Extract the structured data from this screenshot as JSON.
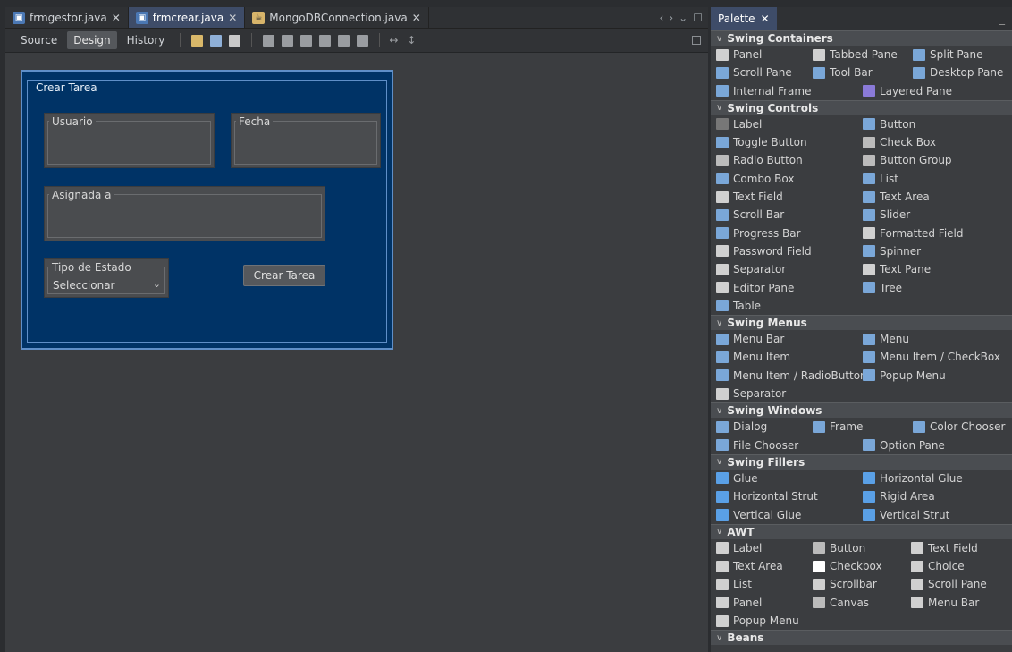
{
  "editor": {
    "tabs": [
      {
        "label": "frmgestor.java",
        "close": "✕",
        "icon": "java-form-file-icon"
      },
      {
        "label": "frmcrear.java",
        "close": "✕",
        "icon": "java-form-file-icon"
      },
      {
        "label": "MongoDBConnection.java",
        "close": "✕",
        "icon": "java-class-file-icon"
      }
    ],
    "views": {
      "source": "Source",
      "design": "Design",
      "history": "History"
    }
  },
  "form": {
    "title": "Crear Tarea",
    "usuario_label": "Usuario",
    "fecha_label": "Fecha",
    "asignada_label": "Asignada a",
    "tipo_estado_label": "Tipo de Estado",
    "combo_value": "Seleccionar",
    "crear_button": "Crear Tarea"
  },
  "palette": {
    "tab_label": "Palette",
    "close": "✕",
    "categories": [
      {
        "name": "Swing Containers",
        "rows": [
          [
            {
              "label": "Panel",
              "icon": "panel-icon",
              "color": "#d0d0d0"
            },
            {
              "label": "Tabbed Pane",
              "icon": "tabbed-pane-icon",
              "color": "#d0d0d0"
            },
            {
              "label": "Split Pane",
              "icon": "split-pane-icon",
              "color": "#7aa7d8"
            }
          ],
          [
            {
              "label": "Scroll Pane",
              "icon": "scroll-pane-icon",
              "color": "#7aa7d8"
            },
            {
              "label": "Tool Bar",
              "icon": "tool-bar-icon",
              "color": "#7aa7d8"
            },
            {
              "label": "Desktop Pane",
              "icon": "desktop-pane-icon",
              "color": "#7aa7d8"
            }
          ],
          [
            {
              "label": "Internal Frame",
              "icon": "internal-frame-icon",
              "color": "#7aa7d8"
            },
            {
              "label": "Layered Pane",
              "icon": "layered-pane-icon",
              "color": "#8a7ad8"
            }
          ]
        ]
      },
      {
        "name": "Swing Controls",
        "rows": [
          [
            {
              "label": "Label",
              "icon": "label-icon",
              "color": "#777"
            },
            {
              "label": "Button",
              "icon": "button-icon",
              "color": "#7aa7d8"
            }
          ],
          [
            {
              "label": "Toggle Button",
              "icon": "toggle-button-icon",
              "color": "#7aa7d8"
            },
            {
              "label": "Check Box",
              "icon": "check-box-icon",
              "color": "#bbbbbb"
            }
          ],
          [
            {
              "label": "Radio Button",
              "icon": "radio-button-icon",
              "color": "#bbbbbb"
            },
            {
              "label": "Button Group",
              "icon": "button-group-icon",
              "color": "#bbbbbb"
            }
          ],
          [
            {
              "label": "Combo Box",
              "icon": "combo-box-icon",
              "color": "#7aa7d8"
            },
            {
              "label": "List",
              "icon": "list-icon",
              "color": "#7aa7d8"
            }
          ],
          [
            {
              "label": "Text Field",
              "icon": "text-field-icon",
              "color": "#d0d0d0"
            },
            {
              "label": "Text Area",
              "icon": "text-area-icon",
              "color": "#7aa7d8"
            }
          ],
          [
            {
              "label": "Scroll Bar",
              "icon": "scroll-bar-icon",
              "color": "#7aa7d8"
            },
            {
              "label": "Slider",
              "icon": "slider-icon",
              "color": "#7aa7d8"
            }
          ],
          [
            {
              "label": "Progress Bar",
              "icon": "progress-bar-icon",
              "color": "#7aa7d8"
            },
            {
              "label": "Formatted Field",
              "icon": "formatted-field-icon",
              "color": "#d0d0d0"
            }
          ],
          [
            {
              "label": "Password Field",
              "icon": "password-field-icon",
              "color": "#d0d0d0"
            },
            {
              "label": "Spinner",
              "icon": "spinner-icon",
              "color": "#7aa7d8"
            }
          ],
          [
            {
              "label": "Separator",
              "icon": "separator-icon",
              "color": "#d0d0d0"
            },
            {
              "label": "Text Pane",
              "icon": "text-pane-icon",
              "color": "#d0d0d0"
            }
          ],
          [
            {
              "label": "Editor Pane",
              "icon": "editor-pane-icon",
              "color": "#d0d0d0"
            },
            {
              "label": "Tree",
              "icon": "tree-icon",
              "color": "#7aa7d8"
            }
          ],
          [
            {
              "label": "Table",
              "icon": "table-icon",
              "color": "#7aa7d8"
            }
          ]
        ]
      },
      {
        "name": "Swing Menus",
        "rows": [
          [
            {
              "label": "Menu Bar",
              "icon": "menu-bar-icon",
              "color": "#7aa7d8"
            },
            {
              "label": "Menu",
              "icon": "menu-icon",
              "color": "#7aa7d8"
            }
          ],
          [
            {
              "label": "Menu Item",
              "icon": "menu-item-icon",
              "color": "#7aa7d8"
            },
            {
              "label": "Menu Item / CheckBox",
              "icon": "menu-item-checkbox-icon",
              "color": "#7aa7d8"
            }
          ],
          [
            {
              "label": "Menu Item / RadioButton",
              "icon": "menu-item-radiobutton-icon",
              "color": "#7aa7d8"
            },
            {
              "label": "Popup Menu",
              "icon": "popup-menu-icon",
              "color": "#7aa7d8"
            }
          ],
          [
            {
              "label": "Separator",
              "icon": "separator-icon",
              "color": "#d0d0d0"
            }
          ]
        ]
      },
      {
        "name": "Swing Windows",
        "rows": [
          [
            {
              "label": "Dialog",
              "icon": "dialog-icon",
              "color": "#7aa7d8"
            },
            {
              "label": "Frame",
              "icon": "frame-icon",
              "color": "#7aa7d8"
            },
            {
              "label": "Color Chooser",
              "icon": "color-chooser-icon",
              "color": "#7aa7d8"
            }
          ],
          [
            {
              "label": "File Chooser",
              "icon": "file-chooser-icon",
              "color": "#7aa7d8"
            },
            {
              "label": "Option Pane",
              "icon": "option-pane-icon",
              "color": "#7aa7d8"
            }
          ]
        ]
      },
      {
        "name": "Swing Fillers",
        "rows": [
          [
            {
              "label": "Glue",
              "icon": "glue-icon",
              "color": "#5aa0e6"
            },
            {
              "label": "Horizontal Glue",
              "icon": "horizontal-glue-icon",
              "color": "#5aa0e6"
            }
          ],
          [
            {
              "label": "Horizontal Strut",
              "icon": "horizontal-strut-icon",
              "color": "#5aa0e6"
            },
            {
              "label": "Rigid Area",
              "icon": "rigid-area-icon",
              "color": "#5aa0e6"
            }
          ],
          [
            {
              "label": "Vertical Glue",
              "icon": "vertical-glue-icon",
              "color": "#5aa0e6"
            },
            {
              "label": "Vertical Strut",
              "icon": "vertical-strut-icon",
              "color": "#5aa0e6"
            }
          ]
        ]
      },
      {
        "name": "AWT",
        "rows": [
          [
            {
              "label": "Label",
              "icon": "awt-label-icon",
              "color": "#d0d0d0"
            },
            {
              "label": "Button",
              "icon": "awt-button-icon",
              "color": "#bbbbbb"
            },
            {
              "label": "Text Field",
              "icon": "awt-text-field-icon",
              "color": "#d0d0d0"
            }
          ],
          [
            {
              "label": "Text Area",
              "icon": "awt-text-area-icon",
              "color": "#d0d0d0"
            },
            {
              "label": "Checkbox",
              "icon": "awt-checkbox-icon",
              "color": "#ffffff"
            },
            {
              "label": "Choice",
              "icon": "awt-choice-icon",
              "color": "#d0d0d0"
            }
          ],
          [
            {
              "label": "List",
              "icon": "awt-list-icon",
              "color": "#d0d0d0"
            },
            {
              "label": "Scrollbar",
              "icon": "awt-scrollbar-icon",
              "color": "#d0d0d0"
            },
            {
              "label": "Scroll Pane",
              "icon": "awt-scroll-pane-icon",
              "color": "#d0d0d0"
            }
          ],
          [
            {
              "label": "Panel",
              "icon": "awt-panel-icon",
              "color": "#d0d0d0"
            },
            {
              "label": "Canvas",
              "icon": "awt-canvas-icon",
              "color": "#bbbbbb"
            },
            {
              "label": "Menu Bar",
              "icon": "awt-menu-bar-icon",
              "color": "#d0d0d0"
            }
          ],
          [
            {
              "label": "Popup Menu",
              "icon": "awt-popup-menu-icon",
              "color": "#d0d0d0"
            }
          ]
        ]
      },
      {
        "name": "Beans",
        "rows": []
      }
    ]
  }
}
